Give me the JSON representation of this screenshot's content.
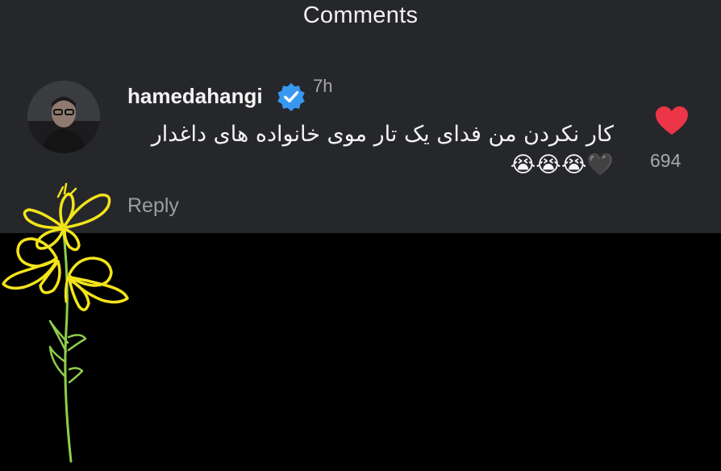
{
  "header": {
    "title": "Comments"
  },
  "comment": {
    "username": "hamedahangi",
    "time": "7h",
    "text": "کار نکردن من فدای یک تار موی خانواده های داغدار🖤😭😭😭",
    "reply_label": "Reply",
    "like_count": "694"
  },
  "icons": {
    "heart": "heart-icon",
    "verified": "verified-badge-icon",
    "flower": "flower-doodle"
  },
  "colors": {
    "panel_bg": "#26272b",
    "verified_blue": "#3897f0",
    "heart_red": "#ed3548",
    "flower_yellow": "#f3e41a",
    "stem_green": "#8ecf4c"
  }
}
